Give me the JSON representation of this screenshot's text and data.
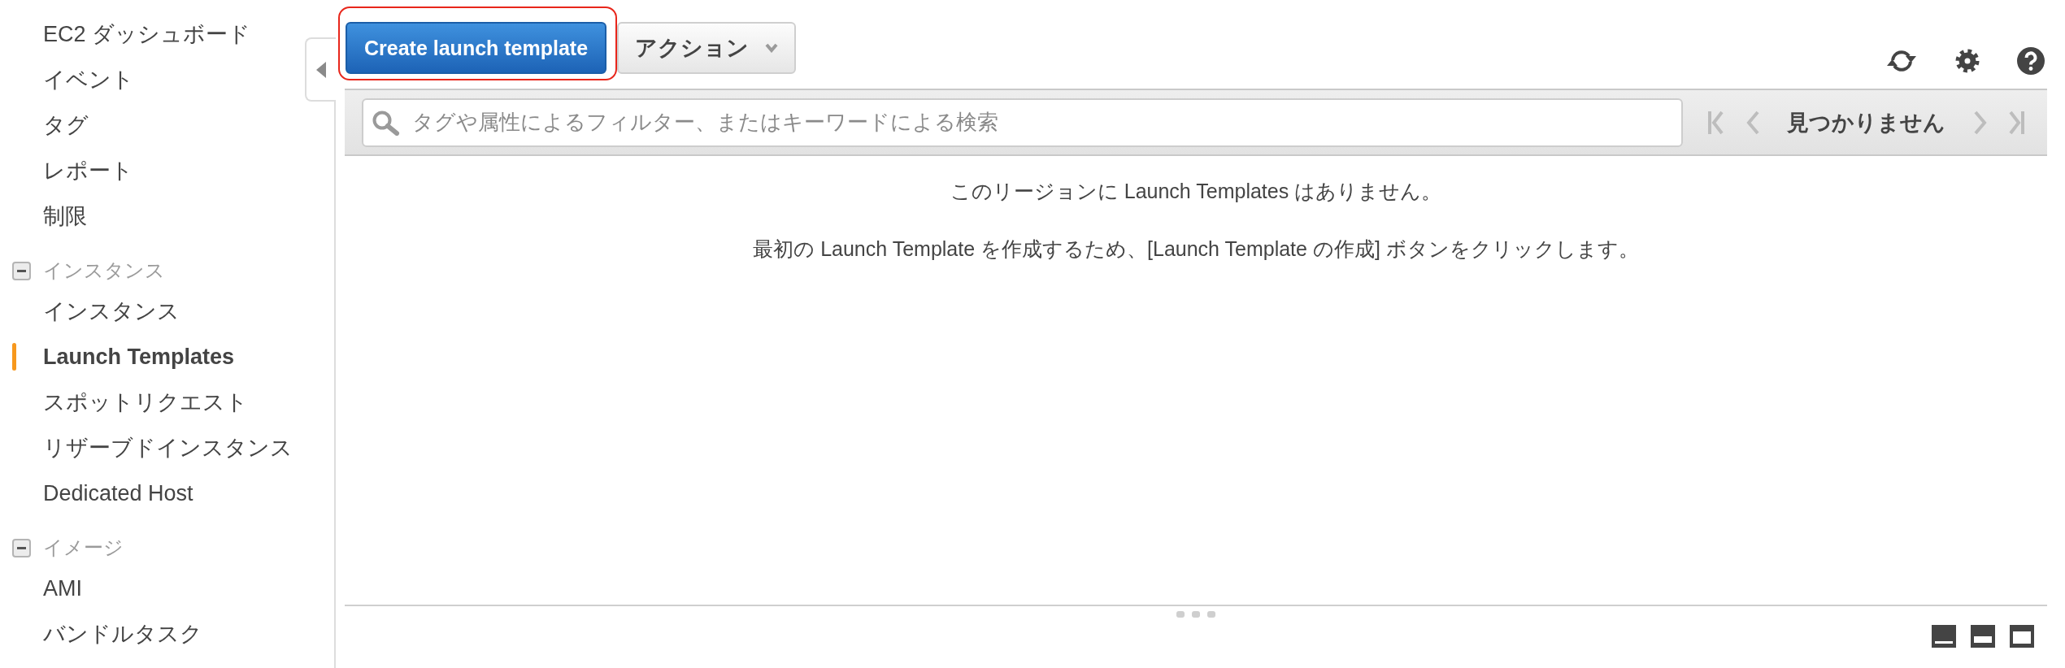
{
  "sidebar": {
    "items": [
      {
        "label": "EC2 ダッシュボード",
        "selected": false
      },
      {
        "label": "イベント",
        "selected": false
      },
      {
        "label": "タグ",
        "selected": false
      },
      {
        "label": "レポート",
        "selected": false
      },
      {
        "label": "制限",
        "selected": false
      }
    ],
    "sections": [
      {
        "label": "インスタンス",
        "expanded": true,
        "items": [
          {
            "label": "インスタンス",
            "selected": false
          },
          {
            "label": "Launch Templates",
            "selected": true
          },
          {
            "label": "スポットリクエスト",
            "selected": false
          },
          {
            "label": "リザーブドインスタンス",
            "selected": false
          },
          {
            "label": "Dedicated Host",
            "selected": false
          }
        ]
      },
      {
        "label": "イメージ",
        "expanded": true,
        "items": [
          {
            "label": "AMI",
            "selected": false
          },
          {
            "label": "バンドルタスク",
            "selected": false
          }
        ]
      }
    ]
  },
  "toolbar": {
    "create_button": {
      "label": "Create launch template",
      "highlighted": true
    },
    "actions_menu": {
      "label": "アクション"
    }
  },
  "filter_bar": {
    "search": {
      "placeholder": "タグや属性によるフィルター、またはキーワードによる検索"
    },
    "pager": {
      "status": "見つかりません",
      "nav_disabled": true
    }
  },
  "empty_state": {
    "lines": [
      "このリージョンに Launch Templates はありません。",
      "最初の Launch Template を作成するため、[Launch Template の作成] ボタンをクリックします。"
    ]
  }
}
